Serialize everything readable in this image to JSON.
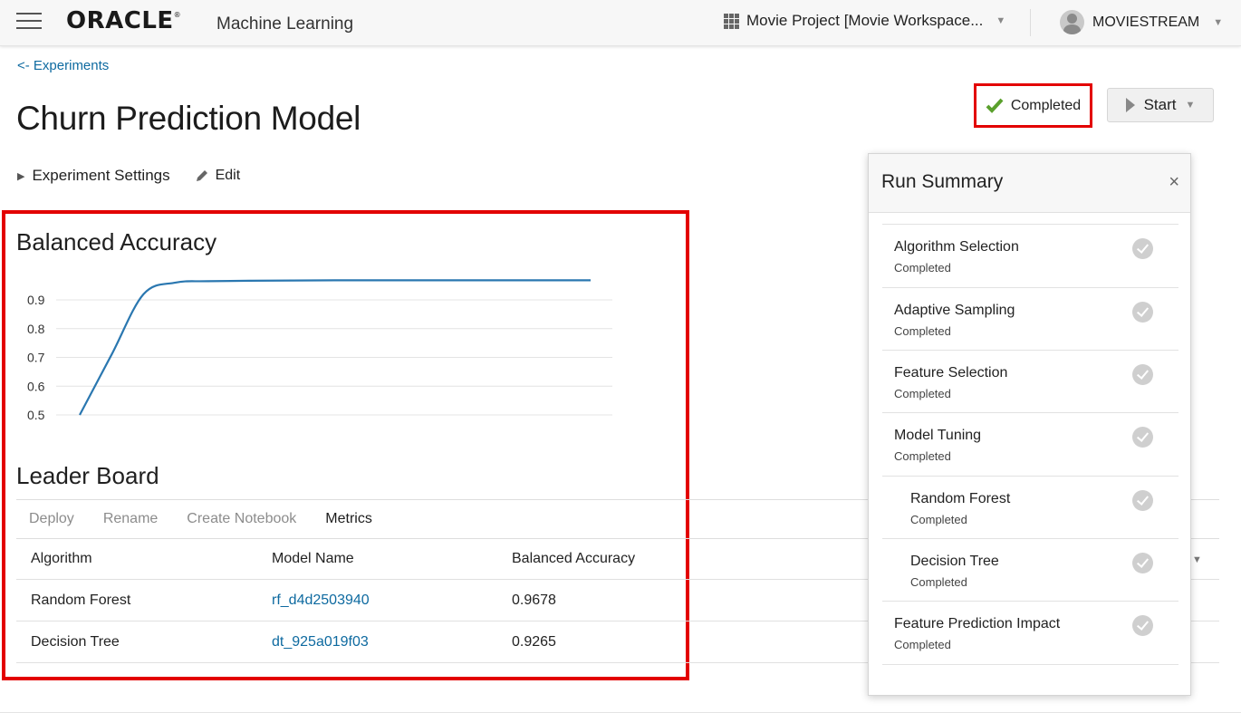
{
  "header": {
    "logo": "ORACLE",
    "logo_mark": "®",
    "product": "Machine Learning",
    "workspace": "Movie Project [Movie Workspace...",
    "user": "MOVIESTREAM"
  },
  "back_link": "<- Experiments",
  "page_title": "Churn Prediction Model",
  "settings_label": "Experiment Settings",
  "edit_label": "Edit",
  "status": {
    "label": "Completed",
    "color": "#5aa02c"
  },
  "start_label": "Start",
  "chart_heading": "Balanced Accuracy",
  "chart_data": {
    "type": "line",
    "title": "Balanced Accuracy",
    "x": [
      0,
      0.5,
      1,
      1.5,
      2,
      3,
      4,
      5,
      6,
      7,
      8
    ],
    "series": [
      {
        "values": [
          0.5,
          0.71,
          0.92,
          0.96,
          0.965,
          0.967,
          0.968,
          0.968,
          0.968,
          0.968,
          0.968
        ]
      }
    ],
    "yticks": [
      "0.9",
      "0.8",
      "0.7",
      "0.6",
      "0.5"
    ],
    "ylim": [
      0.5,
      0.9
    ],
    "xlabel": "",
    "ylabel": "",
    "grid": true,
    "line_color": "#2a77b0"
  },
  "leaderboard": {
    "heading": "Leader Board",
    "tabs": [
      "Deploy",
      "Rename",
      "Create Notebook",
      "Metrics"
    ],
    "columns": [
      "Algorithm",
      "Model Name",
      "Balanced Accuracy"
    ],
    "rows": [
      {
        "algorithm": "Random Forest",
        "model": "rf_d4d2503940",
        "accuracy": "0.9678"
      },
      {
        "algorithm": "Decision Tree",
        "model": "dt_925a019f03",
        "accuracy": "0.9265"
      }
    ]
  },
  "run_summary": {
    "title": "Run Summary",
    "close": "×",
    "stages": [
      {
        "name": "Algorithm Selection",
        "status": "Completed"
      },
      {
        "name": "Adaptive Sampling",
        "status": "Completed"
      },
      {
        "name": "Feature Selection",
        "status": "Completed"
      },
      {
        "name": "Model Tuning",
        "status": "Completed"
      },
      {
        "name": "Random Forest",
        "status": "Completed"
      },
      {
        "name": "Decision Tree",
        "status": "Completed"
      },
      {
        "name": "Feature Prediction Impact",
        "status": "Completed"
      }
    ]
  }
}
